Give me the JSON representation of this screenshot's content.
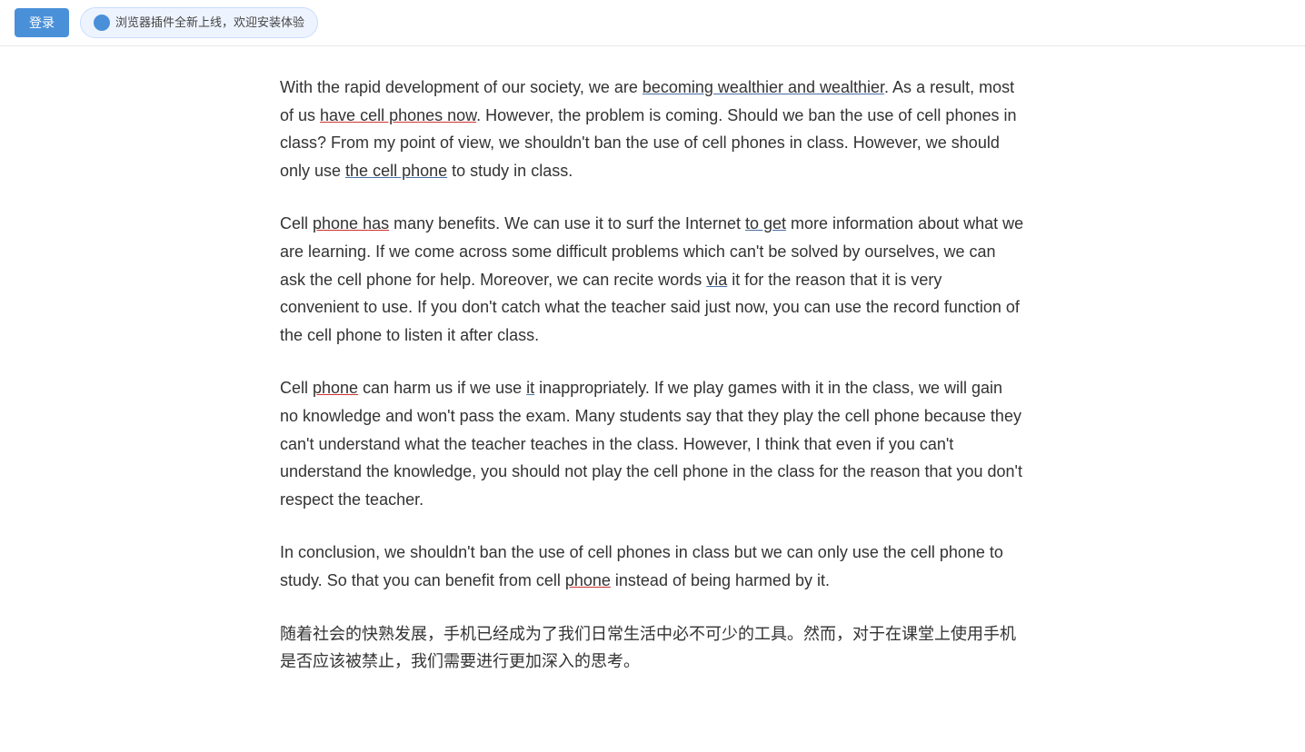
{
  "topbar": {
    "login_label": "登录",
    "plugin_text": "浏览器插件全新上线，欢迎安装体验"
  },
  "paragraphs": {
    "p1": "With the rapid development of our society, we are becoming wealthier and wealthier. As a result, most of us have cell phones now. However, the problem is coming. Should we ban the use of cell phones in class? From my point of view, we shouldn't ban the use of cell phones in class. However, we should only use the cell phone to study in class.",
    "p2": "Cell phone has many benefits. We can use it to surf the Internet to get more information about what we are learning. If we come across some difficult problems which can't be solved by ourselves, we can ask the cell phone for help. Moreover, we can recite words via it for the reason that it is very convenient to use. If you don't catch what the teacher said just now, you can use the record function of the cell phone to listen it after class.",
    "p3": "Cell phone can harm us if we use it inappropriately. If we play games with it in the class, we will gain no knowledge and won't pass the exam. Many students say that they play the cell phone because they can't understand what the teacher teaches in the class. However, I think that even if you can't understand the knowledge, you should not play the cell phone in the class for the reason that you don't respect the teacher.",
    "p4": "In conclusion, we shouldn't ban the use of cell phones in class but we can only use the cell phone to study. So that you can benefit from cell phone instead of being harmed by it.",
    "p5_line1": "随着社会的快熟发展，手机已经成为了我们日常生活中必不可少的工具。然而，对于在课堂上使用手机是否",
    "p5_line2": "应该被禁止，我们需要进行更加深入的思考。"
  },
  "underlines": {
    "becoming_wealthier": "becoming wealthier and wealthier",
    "have_cell_phones_now": "have cell phones now",
    "the_cell_phone": "the cell phone",
    "phone_has": "phone has",
    "to_get": "to get",
    "via": "via",
    "phone_harm": "phone",
    "it": "it",
    "phone_benefit": "phone"
  }
}
